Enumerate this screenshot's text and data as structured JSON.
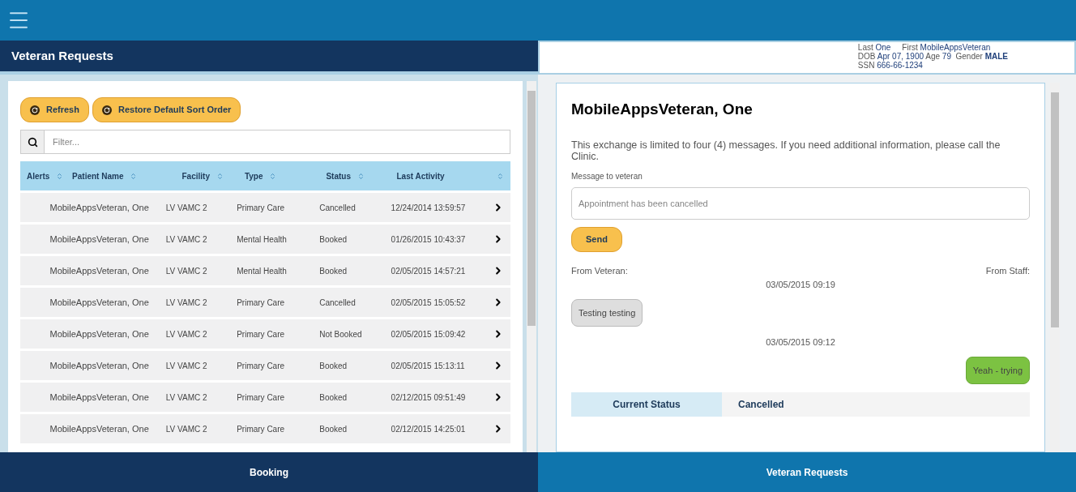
{
  "left_header": {
    "title": "Veteran Requests"
  },
  "patient_info": {
    "last_label": "Last",
    "last": "One",
    "first_label": "First",
    "first": "MobileAppsVeteran",
    "dob_label": "DOB",
    "dob": "Apr 07, 1900",
    "age_label": "Age",
    "age": "79",
    "gender_label": "Gender",
    "gender": "MALE",
    "ssn_label": "SSN",
    "ssn": "666-66-1234"
  },
  "toolbar": {
    "buttons": [
      "Refresh",
      "Restore Default Sort Order"
    ]
  },
  "filter": {
    "placeholder": "Filter..."
  },
  "table": {
    "columns": [
      "Alerts",
      "Patient Name",
      "Facility",
      "Type",
      "Status",
      "Last Activity"
    ],
    "rows": [
      {
        "patient": "MobileAppsVeteran, One",
        "facility": "LV VAMC 2",
        "type": "Primary Care",
        "status": "Cancelled",
        "last_activity": "12/24/2014 13:59:57"
      },
      {
        "patient": "MobileAppsVeteran, One",
        "facility": "LV VAMC 2",
        "type": "Mental Health",
        "status": "Booked",
        "last_activity": "01/26/2015 10:43:37"
      },
      {
        "patient": "MobileAppsVeteran, One",
        "facility": "LV VAMC 2",
        "type": "Mental Health",
        "status": "Booked",
        "last_activity": "02/05/2015 14:57:21"
      },
      {
        "patient": "MobileAppsVeteran, One",
        "facility": "LV VAMC 2",
        "type": "Primary Care",
        "status": "Cancelled",
        "last_activity": "02/05/2015 15:05:52"
      },
      {
        "patient": "MobileAppsVeteran, One",
        "facility": "LV VAMC 2",
        "type": "Primary Care",
        "status": "Not Booked",
        "last_activity": "02/05/2015 15:09:42"
      },
      {
        "patient": "MobileAppsVeteran, One",
        "facility": "LV VAMC 2",
        "type": "Primary Care",
        "status": "Booked",
        "last_activity": "02/05/2015 15:13:11"
      },
      {
        "patient": "MobileAppsVeteran, One",
        "facility": "LV VAMC 2",
        "type": "Primary Care",
        "status": "Booked",
        "last_activity": "02/12/2015 09:51:49"
      },
      {
        "patient": "MobileAppsVeteran, One",
        "facility": "LV VAMC 2",
        "type": "Primary Care",
        "status": "Booked",
        "last_activity": "02/12/2015 14:25:01"
      }
    ]
  },
  "detail": {
    "title": "MobileAppsVeteran, One",
    "notice": "This exchange is limited to four (4) messages. If you need additional information, please call the Clinic.",
    "message_label": "Message to veteran",
    "message_placeholder": "Appointment has been cancelled",
    "send": "Send",
    "from_veteran": "From Veteran:",
    "from_staff": "From Staff:",
    "messages": [
      {
        "time": "03/05/2015 09:19",
        "text": "Testing testing",
        "kind": "incoming"
      },
      {
        "time": "03/05/2015 09:12",
        "text": "Yeah - trying",
        "kind": "outgoing"
      }
    ],
    "status_label": "Current Status",
    "status_value": "Cancelled"
  },
  "bottom_tabs": [
    {
      "label": "Booking",
      "selected": false
    },
    {
      "label": "Veteran Requests",
      "selected": true
    }
  ]
}
